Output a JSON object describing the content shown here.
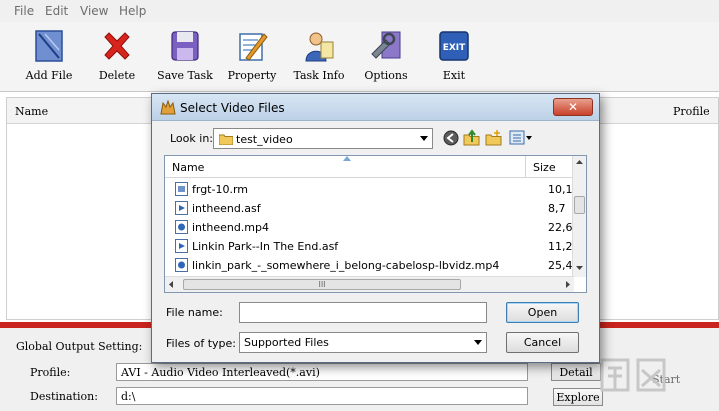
{
  "menu": {
    "items": [
      "File",
      "Edit",
      "View",
      "Help"
    ]
  },
  "toolbar": {
    "buttons": [
      {
        "label": "Add File",
        "icon": "add-file-icon"
      },
      {
        "label": "Delete",
        "icon": "delete-icon"
      },
      {
        "label": "Save Task",
        "icon": "save-icon"
      },
      {
        "label": "Property",
        "icon": "property-icon"
      },
      {
        "label": "Task Info",
        "icon": "task-info-icon"
      },
      {
        "label": "Options",
        "icon": "options-icon"
      },
      {
        "label": "Exit",
        "icon": "exit-icon"
      }
    ]
  },
  "file_list": {
    "columns": {
      "name": "Name",
      "profile": "Profile"
    }
  },
  "settings": {
    "heading": "Global Output Setting:",
    "profile_label": "Profile:",
    "profile_value": "AVI - Audio Video Interleaved(*.avi)",
    "detail_button": "Detail",
    "destination_label": "Destination:",
    "destination_value": "d:\\",
    "explore_button": "Explore",
    "start_button": "Start"
  },
  "dialog": {
    "title": "Select Video Files",
    "look_in_label": "Look in:",
    "look_in_value": "test_video",
    "columns": {
      "name": "Name",
      "size": "Size"
    },
    "files": [
      {
        "name": "frgt-10.rm",
        "size": "10,1(",
        "icon": "media-file-icon"
      },
      {
        "name": "intheend.asf",
        "size": "8,7",
        "icon": "media-file-icon"
      },
      {
        "name": "intheend.mp4",
        "size": "22,6!",
        "icon": "media-file-icon"
      },
      {
        "name": "Linkin Park--In The End.asf",
        "size": "11,2(",
        "icon": "media-file-icon"
      },
      {
        "name": "linkin_park_-_somewhere_i_belong-cabelosp-lbvidz.mp4",
        "size": "25,4",
        "icon": "media-file-icon"
      }
    ],
    "hscroll_grip": "III",
    "file_name_label": "File name:",
    "file_name_value": "",
    "files_of_type_label": "Files of type:",
    "files_of_type_value": "Supported Files",
    "open_button": "Open",
    "cancel_button": "Cancel",
    "close_button": "✕"
  }
}
